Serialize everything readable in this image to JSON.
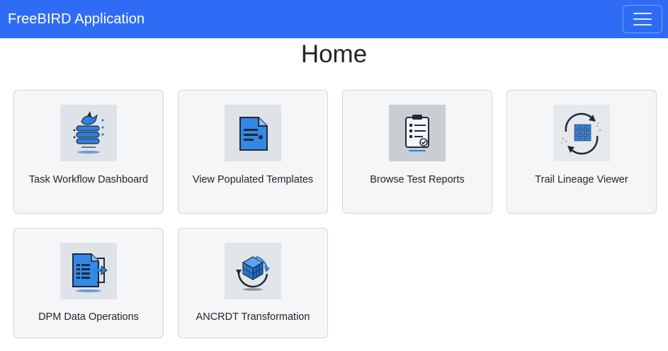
{
  "navbar": {
    "brand": "FreeBIRD Application"
  },
  "page": {
    "title": "Home"
  },
  "cards": [
    {
      "label": "Task Workflow Dashboard",
      "icon": "bird-database-icon"
    },
    {
      "label": "View Populated Templates",
      "icon": "document-icon"
    },
    {
      "label": "Browse Test Reports",
      "icon": "clipboard-checklist-icon"
    },
    {
      "label": "Trail Lineage Viewer",
      "icon": "data-cube-cycle-icon"
    },
    {
      "label": "DPM Data Operations",
      "icon": "data-table-export-icon"
    },
    {
      "label": "ANCRDT Transformation",
      "icon": "cube-transform-icon"
    }
  ],
  "colors": {
    "navbar": "#2f6cf6",
    "card_bg": "#f5f6f8",
    "card_border": "#d3d6da",
    "accent_blue": "#2f7fe0"
  }
}
